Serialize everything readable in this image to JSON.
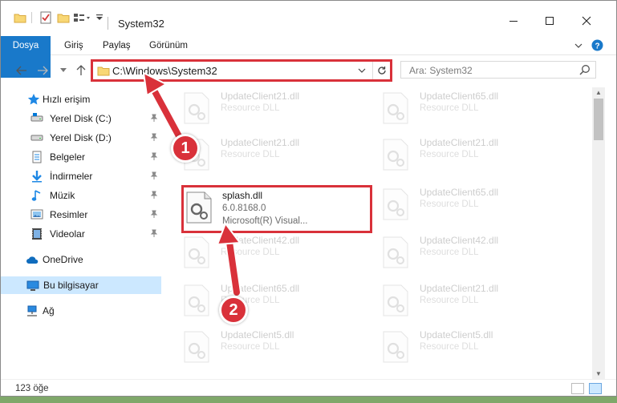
{
  "window": {
    "title": "System32",
    "minimize_icon": "minimize-icon",
    "maximize_icon": "maximize-icon",
    "close_icon": "close-icon"
  },
  "ribbon": {
    "tabs": [
      "Dosya",
      "Giriş",
      "Paylaş",
      "Görünüm"
    ],
    "expand_icon": "chevron-down-icon",
    "help_icon": "help-icon"
  },
  "navigation": {
    "address": "C:\\Windows\\System32",
    "search_placeholder": "Ara: System32"
  },
  "sidebar": {
    "quick_access": "Hızlı erişim",
    "items": [
      {
        "label": "Yerel Disk (C:)",
        "icon": "drive-icon"
      },
      {
        "label": "Yerel Disk (D:)",
        "icon": "drive-icon"
      },
      {
        "label": "Belgeler",
        "icon": "documents-icon"
      },
      {
        "label": "İndirmeler",
        "icon": "download-icon"
      },
      {
        "label": "Müzik",
        "icon": "music-icon"
      },
      {
        "label": "Resimler",
        "icon": "pictures-icon"
      },
      {
        "label": "Videolar",
        "icon": "videos-icon"
      }
    ],
    "onedrive": "OneDrive",
    "this_pc": "Bu bilgisayar",
    "network": "Ağ"
  },
  "files": {
    "left": [
      {
        "name": "UpdateClient21.dll",
        "desc": "Resource DLL"
      },
      {
        "name": "UpdateClient21.dll",
        "desc": "Resource DLL"
      },
      {
        "name": "splash.dll",
        "version": "6.0.8168.0",
        "desc": "Microsoft(R) Visual..."
      },
      {
        "name": "UpdateClient42.dll",
        "desc": "Resource DLL"
      },
      {
        "name": "UpdateClient65.dll",
        "desc": "Resource DLL"
      },
      {
        "name": "UpdateClient5.dll",
        "desc": "Resource DLL"
      }
    ],
    "right": [
      {
        "name": "UpdateClient65.dll",
        "desc": "Resource DLL"
      },
      {
        "name": "UpdateClient21.dll",
        "desc": "Resource DLL"
      },
      {
        "name": "UpdateClient65.dll",
        "desc": "Resource DLL"
      },
      {
        "name": "UpdateClient42.dll",
        "desc": "Resource DLL"
      },
      {
        "name": "UpdateClient21.dll",
        "desc": "Resource DLL"
      },
      {
        "name": "UpdateClient5.dll",
        "desc": "Resource DLL"
      }
    ]
  },
  "status": {
    "count": "123 öğe"
  },
  "annotations": {
    "badge1": "1",
    "badge2": "2",
    "highlight_color": "#d9313a"
  }
}
